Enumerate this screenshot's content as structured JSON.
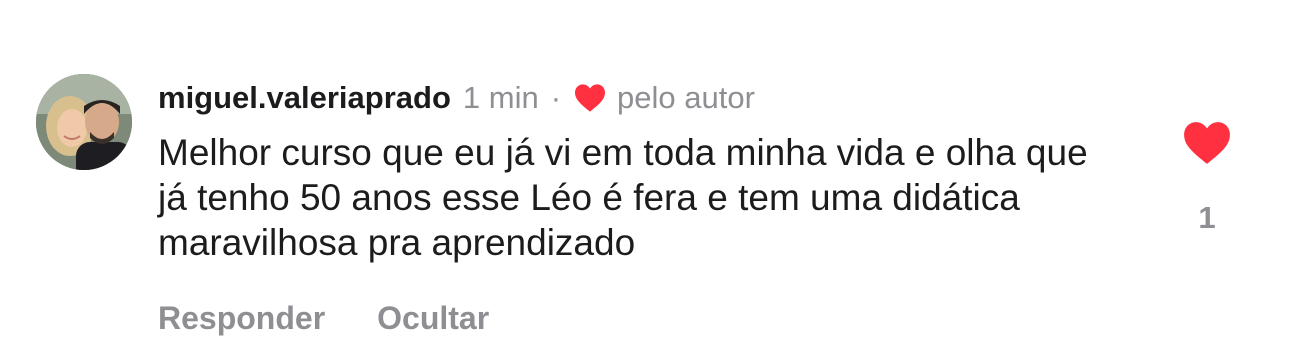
{
  "comment": {
    "username": "miguel.valeriaprado",
    "time": "1 min",
    "separator": "·",
    "author_liked_label": "pelo autor",
    "text": "Melhor curso que eu já vi em toda minha vida e olha que já tenho 50 anos esse Léo é fera e tem uma didática maravilhosa pra aprendizado",
    "like_count": "1",
    "liked": true,
    "actions": {
      "reply_label": "Responder",
      "hide_label": "Ocultar"
    }
  },
  "icons": {
    "author_heart": "heart-icon",
    "like_heart": "heart-icon"
  },
  "colors": {
    "heart": "#ff3040",
    "secondary_text": "#8e8e93",
    "primary_text": "#1c1c1e"
  }
}
